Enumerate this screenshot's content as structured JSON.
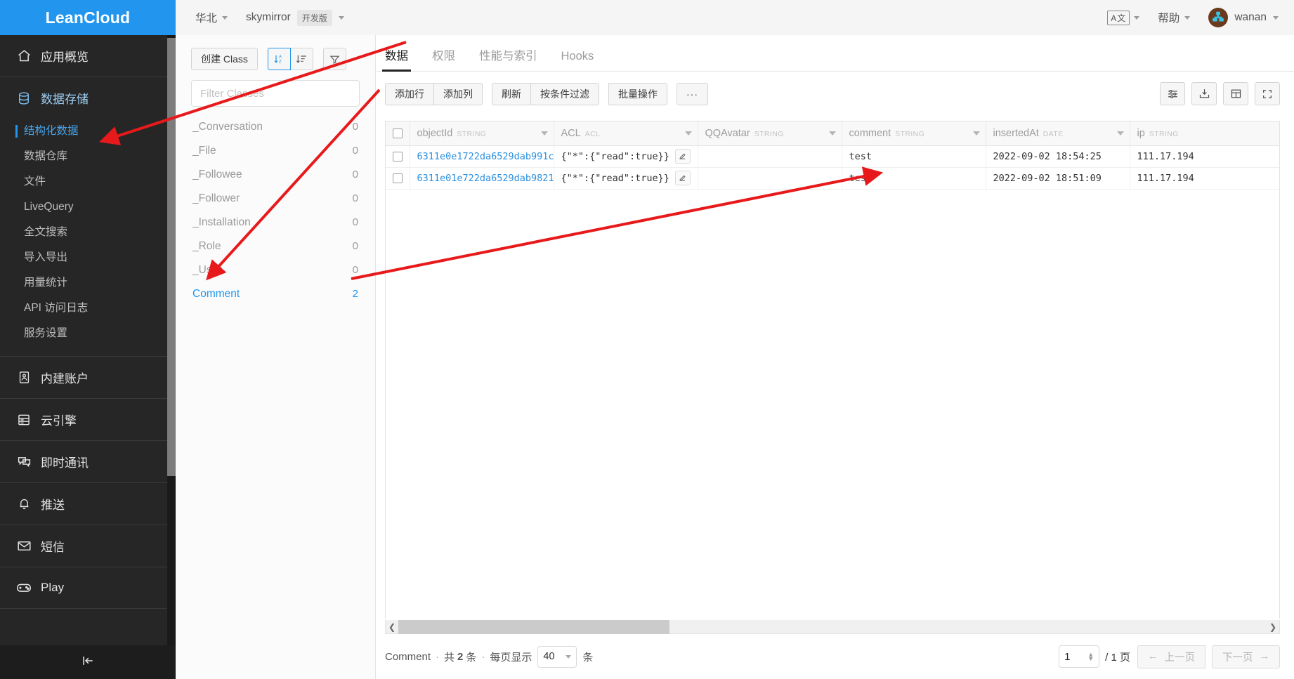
{
  "brand": {
    "name": "LeanCloud"
  },
  "header": {
    "region": "华北",
    "app_name": "skymirror",
    "app_badge": "开发版",
    "lang_icon": "A文",
    "help": "帮助",
    "user": "wanan"
  },
  "sidebar": {
    "overview": {
      "label": "应用概览",
      "icon": "home-icon"
    },
    "storage": {
      "label": "数据存储",
      "icon": "database-icon"
    },
    "storage_children": [
      {
        "label": "结构化数据",
        "active": true
      },
      {
        "label": "数据仓库",
        "active": false
      },
      {
        "label": "文件",
        "active": false
      },
      {
        "label": "LiveQuery",
        "active": false
      },
      {
        "label": "全文搜索",
        "active": false
      },
      {
        "label": "导入导出",
        "active": false
      },
      {
        "label": "用量统计",
        "active": false
      },
      {
        "label": "API 访问日志",
        "active": false
      },
      {
        "label": "服务设置",
        "active": false
      }
    ],
    "sections": [
      {
        "label": "内建账户",
        "icon": "id-card-icon"
      },
      {
        "label": "云引擎",
        "icon": "server-icon"
      },
      {
        "label": "即时通讯",
        "icon": "chat-icon"
      },
      {
        "label": "推送",
        "icon": "bell-icon"
      },
      {
        "label": "短信",
        "icon": "envelope-icon"
      },
      {
        "label": "Play",
        "icon": "gamepad-icon"
      }
    ],
    "collapse_icon": "collapse-sidebar-icon"
  },
  "classpanel": {
    "create_button": "创建 Class",
    "sort_alpha_icon": "sort-alpha-icon",
    "sort_list_icon": "sort-list-icon",
    "filter_icon": "funnel-icon",
    "filter_placeholder": "Filter Classes",
    "filter_value": "",
    "classes": [
      {
        "name": "_Conversation",
        "count": "0",
        "selected": false
      },
      {
        "name": "_File",
        "count": "0",
        "selected": false
      },
      {
        "name": "_Followee",
        "count": "0",
        "selected": false
      },
      {
        "name": "_Follower",
        "count": "0",
        "selected": false
      },
      {
        "name": "_Installation",
        "count": "0",
        "selected": false
      },
      {
        "name": "_Role",
        "count": "0",
        "selected": false
      },
      {
        "name": "_User",
        "count": "0",
        "selected": false
      },
      {
        "name": "Comment",
        "count": "2",
        "selected": true
      }
    ]
  },
  "main": {
    "tabs": [
      {
        "label": "数据",
        "active": true
      },
      {
        "label": "权限",
        "active": false
      },
      {
        "label": "性能与索引",
        "active": false
      },
      {
        "label": "Hooks",
        "active": false
      }
    ],
    "toolbar": {
      "add_row": "添加行",
      "add_column": "添加列",
      "refresh": "刷新",
      "filter_by_condition": "按条件过滤",
      "batch_operation": "批量操作",
      "more": "···",
      "right_icons": [
        {
          "name": "settings-sliders-icon"
        },
        {
          "name": "export-download-icon"
        },
        {
          "name": "table-view-icon"
        },
        {
          "name": "fullscreen-icon"
        }
      ]
    },
    "table": {
      "columns": [
        {
          "name": "objectId",
          "type": "STRING"
        },
        {
          "name": "ACL",
          "type": "ACL"
        },
        {
          "name": "QQAvatar",
          "type": "STRING"
        },
        {
          "name": "comment",
          "type": "STRING"
        },
        {
          "name": "insertedAt",
          "type": "DATE"
        },
        {
          "name": "ip",
          "type": "STRING"
        }
      ],
      "rows": [
        {
          "objectId": "6311e0e1722da6529dab991c",
          "acl": "{\"*\":{\"read\":true}}",
          "qqavatar": "",
          "comment": "test",
          "insertedAt": "2022-09-02 18:54:25",
          "ip": "111.17.194"
        },
        {
          "objectId": "6311e01e722da6529dab9821",
          "acl": "{\"*\":{\"read\":true}}",
          "qqavatar": "",
          "comment": "test",
          "insertedAt": "2022-09-02 18:51:09",
          "ip": "111.17.194"
        }
      ],
      "copy_icon": "copy-icon",
      "edit_icon": "edit-pencil-icon"
    },
    "footer": {
      "class_name": "Comment",
      "sep1": "·",
      "total_prefix": "共",
      "total_count": "2",
      "total_suffix": "条",
      "sep2": "·",
      "per_page_label": "每页显示",
      "per_page_value": "40",
      "per_page_unit": "条",
      "page_value": "1",
      "page_total": "/ 1 页",
      "prev_page": "上一页",
      "next_page": "下一页"
    }
  },
  "colors": {
    "brand_blue": "#2296ee",
    "sidebar_bg": "#262626",
    "link_blue": "#2a8fe0",
    "annotation_red": "#e8191b"
  }
}
